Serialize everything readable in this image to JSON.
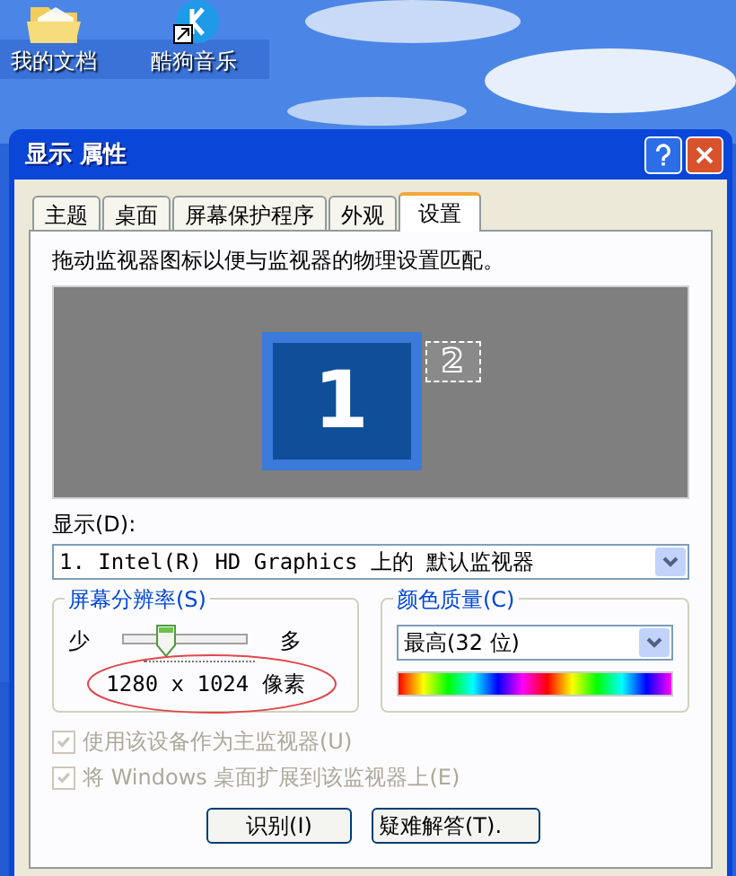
{
  "desktop": {
    "icons": [
      {
        "label": "我的文档",
        "kind": "folder"
      },
      {
        "label": "酷狗音乐",
        "kind": "app"
      }
    ]
  },
  "window": {
    "title": "显示 属性"
  },
  "tabs": [
    {
      "label": "主题",
      "selected": false
    },
    {
      "label": "桌面",
      "selected": false
    },
    {
      "label": "屏幕保护程序",
      "selected": false
    },
    {
      "label": "外观",
      "selected": false
    },
    {
      "label": "设置",
      "selected": true
    }
  ],
  "instruction": "拖动监视器图标以便与监视器的物理设置匹配。",
  "monitors": [
    {
      "label": "1",
      "selected": true
    },
    {
      "label": "2",
      "selected": false
    }
  ],
  "display": {
    "label": "显示(D):",
    "value": "1. Intel(R) HD Graphics 上的 默认监视器"
  },
  "resolution": {
    "title": "屏幕分辨率(S)",
    "min_label": "少",
    "max_label": "多",
    "level": 0.35,
    "reading": "1280 x 1024 像素"
  },
  "color_quality": {
    "title": "颜色质量(C)",
    "value": "最高(32 位)"
  },
  "checkboxes": [
    {
      "label": "使用该设备作为主监视器(U)",
      "checked": true,
      "disabled": true
    },
    {
      "label": "将 Windows 桌面扩展到该监视器上(E)",
      "checked": true,
      "disabled": true
    }
  ],
  "buttons": [
    "识别(I)",
    "疑难解答(T)."
  ]
}
